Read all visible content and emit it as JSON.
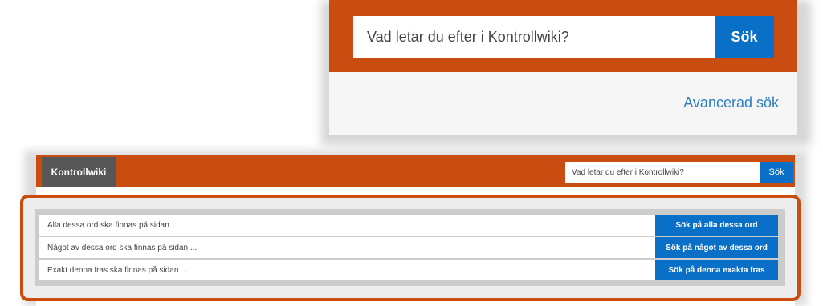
{
  "zoom": {
    "search_placeholder": "Vad letar du efter i Kontrollwiki?",
    "search_button": "Sök",
    "advanced_link": "Avancerad sök"
  },
  "header": {
    "brand": "Kontrollwiki",
    "search_placeholder": "Vad letar du efter i Kontrollwiki?",
    "search_button": "Sök"
  },
  "advanced": {
    "rows": [
      {
        "placeholder": "Alla dessa ord ska finnas på sidan ...",
        "button": "Sök på alla dessa ord"
      },
      {
        "placeholder": "Något av dessa ord ska finnas på sidan ...",
        "button": "Sök på något av dessa ord"
      },
      {
        "placeholder": "Exakt denna fras ska finnas på sidan ...",
        "button": "Sök på denna exakta fras"
      }
    ]
  },
  "colors": {
    "brand_orange": "#c94c11",
    "button_blue": "#0a6fc7",
    "link_blue": "#2f7fc3",
    "brand_gray": "#575757"
  }
}
